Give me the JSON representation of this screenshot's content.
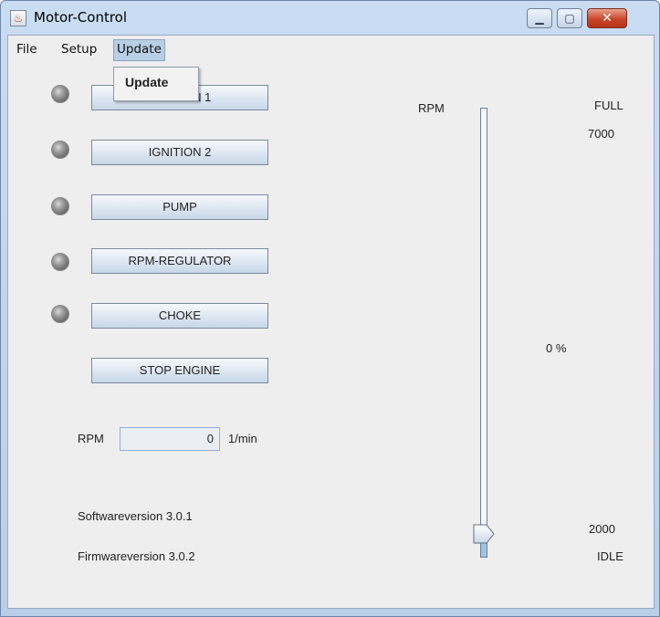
{
  "window": {
    "title": "Motor-Control",
    "min_glyph": "▁",
    "max_glyph": "▢",
    "close_glyph": "✕",
    "icon_glyph": "♨"
  },
  "menubar": {
    "file": "File",
    "setup": "Setup",
    "update": "Update"
  },
  "dropdown": {
    "item": "Update"
  },
  "buttons": {
    "ignition1": "IGNITION 1",
    "ignition2": "IGNITION 2",
    "pump": "PUMP",
    "rpm_regulator": "RPM-REGULATOR",
    "choke": "CHOKE",
    "stop_engine": "STOP ENGINE"
  },
  "rpm": {
    "label": "RPM",
    "value": "0",
    "unit": "1/min"
  },
  "versions": {
    "software": "Softwareversion 3.0.1",
    "firmware": "Firmwareversion 3.0.2"
  },
  "slider": {
    "title": "RPM",
    "top_label": "FULL",
    "max_value": "7000",
    "percent": "0 %",
    "min_value": "2000",
    "bottom_label": "IDLE",
    "level_fraction": 0
  },
  "colors": {
    "accent": "#b8cfe5",
    "close": "#c9452a"
  }
}
